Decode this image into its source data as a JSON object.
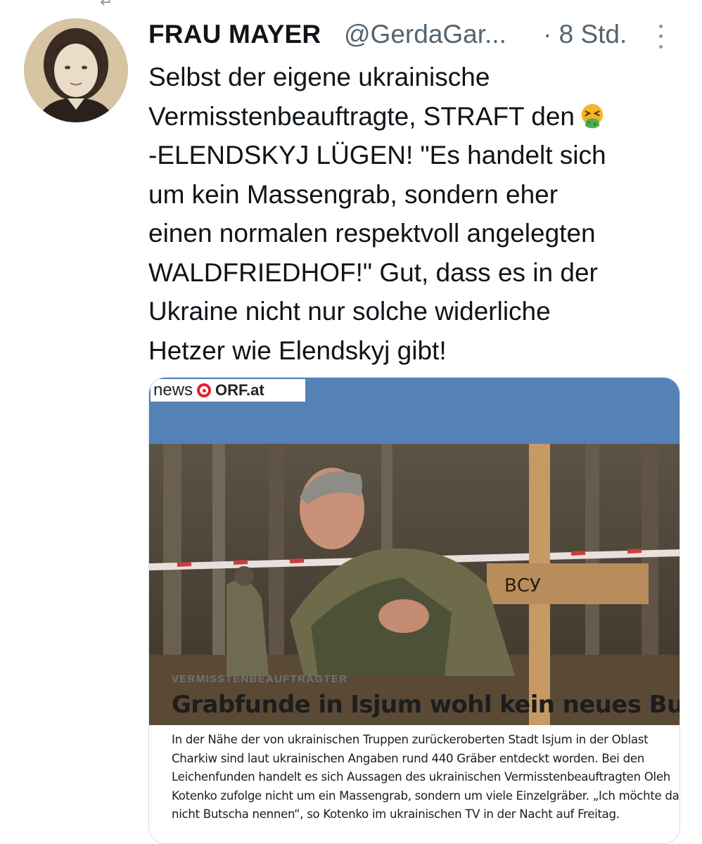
{
  "tweet": {
    "author_name": "FRAU MAYER",
    "handle": "@GerdaGar...",
    "timestamp": "· 8 Std.",
    "text_lines": [
      "Selbst der eigene ukrainische",
      "Vermisstenbeauftragte, STRAFT den",
      "-ELENDSKYJ LÜGEN! \"Es handelt sich",
      "um kein Massengrab, sondern eher",
      "einen normalen respektvoll angelegten",
      "WALDFRIEDHOF!\" Gut, dass es in der",
      "Ukraine nicht nur solche widerliche",
      "Hetzer wie Elendskyj gibt!"
    ],
    "emoji": "nauseated-face-icon"
  },
  "card": {
    "logo_news": "news",
    "logo_orf": "ORF.at",
    "photo_sign_text": "ВСУ",
    "kicker": "VERMISSTENBEAUFTRAGTER",
    "headline": "Grabfunde in Isjum wohl kein neues Butscha",
    "teaser_lines": [
      "In der Nähe der von ukrainischen Truppen zurückeroberten Stadt Isjum in der Oblast",
      "Charkiw sind laut ukrainischen Angaben rund 440 Gräber entdeckt worden. Bei den",
      "Leichenfunden handelt es sich Aussagen des ukrainischen Vermisstenbeauftragten Oleh",
      "Kotenko zufolge nicht um ein Massengrab, sondern um viele Einzelgräber. „Ich möchte das",
      "nicht Butscha nennen“, so Kotenko im ukrainischen TV in der Nacht auf Freitag."
    ]
  },
  "colors": {
    "text_primary": "#0f1419",
    "text_secondary": "#536471",
    "card_header": "#5582b6",
    "orf_red": "#e4202e",
    "emoji_face": "#f2b52b",
    "emoji_vomit": "#4cae4f"
  }
}
